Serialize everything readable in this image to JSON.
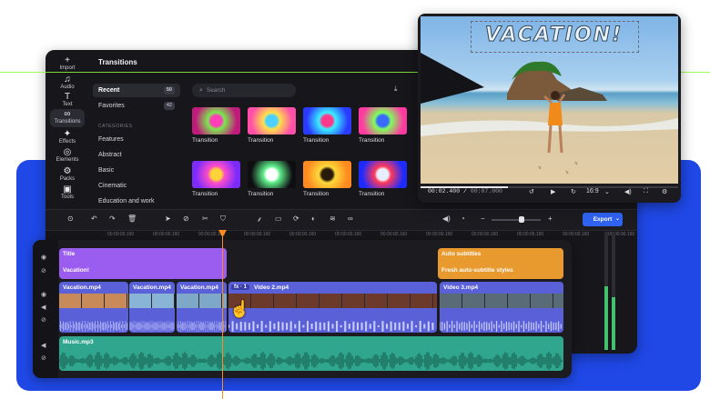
{
  "sidebar": {
    "items": [
      {
        "label": "Import",
        "icon": "plus-icon"
      },
      {
        "label": "Audio",
        "icon": "music-icon"
      },
      {
        "label": "Text",
        "icon": "text-icon"
      },
      {
        "label": "Transitions",
        "icon": "transitions-icon"
      },
      {
        "label": "Effects",
        "icon": "effects-icon"
      },
      {
        "label": "Elements",
        "icon": "elements-icon"
      },
      {
        "label": "Packs",
        "icon": "packs-icon"
      },
      {
        "label": "Tools",
        "icon": "tools-icon"
      }
    ],
    "active": "Transitions"
  },
  "panel": {
    "title": "Transitions",
    "categories": [
      {
        "label": "Recent",
        "count": "50"
      },
      {
        "label": "Favorites",
        "count": "42"
      }
    ],
    "categories_heading": "CATEGORIES",
    "category_list": [
      "Features",
      "Abstract",
      "Basic",
      "Cinematic",
      "Education and work"
    ],
    "search_placeholder": "Search",
    "thumbnails": [
      {
        "label": "Transition",
        "colors": [
          "#c01a7a",
          "#7be84f",
          "#ff3fb7"
        ]
      },
      {
        "label": "Transition",
        "colors": [
          "#ff4fa8",
          "#ffe14a",
          "#4ad1ff"
        ]
      },
      {
        "label": "Transition",
        "colors": [
          "#2a3bff",
          "#3af0ff",
          "#ff3a8c"
        ]
      },
      {
        "label": "Transition",
        "colors": [
          "#ff3aa1",
          "#7dff5a",
          "#3a6bff"
        ]
      },
      {
        "label": "Transition",
        "colors": [
          "#7c2bff",
          "#ff4ec6",
          "#ffd23a"
        ]
      },
      {
        "label": "Transition",
        "colors": [
          "#0f0f12",
          "#5ef08a",
          "#ffffff"
        ]
      },
      {
        "label": "Transition",
        "colors": [
          "#ff8a1f",
          "#ffd93a",
          "#2a1a0a"
        ]
      },
      {
        "label": "Transition",
        "colors": [
          "#1e2bff",
          "#ff3a5a",
          "#e8f0ff"
        ]
      }
    ]
  },
  "preview": {
    "overlay_title": "VACATION!",
    "time_current": "00:02.400",
    "time_total": "00:07.000",
    "progress": 0.34,
    "aspect": "16:9"
  },
  "toolbar": {
    "export_label": "Export",
    "ruler_ticks": [
      "00:00:00.160",
      "00:00:00.160",
      "00:00:00.160",
      "00:00:00.160",
      "00:00:00.160",
      "00:00:00.160",
      "00:00:00.160",
      "00:00:00.160",
      "00:00:00.160",
      "00:00:00.160",
      "00:00:00.160",
      "00:00:00.160"
    ]
  },
  "timeline": {
    "text_clips": [
      {
        "title": "Title",
        "subtitle": "Vacation!",
        "color": "#9b5cf0"
      },
      {
        "title": "Auto subtitles",
        "subtitle": "Fresh auto-subtitle styles",
        "color": "#e89a2f"
      }
    ],
    "video_clips": [
      {
        "label": "Vacation.mp4"
      },
      {
        "label": "Vacation.mp4"
      },
      {
        "label": "Vacation.mp4"
      },
      {
        "label": "Video 2.mp4",
        "badge": "fx · 1"
      },
      {
        "label": "Video 3.mp4"
      }
    ],
    "audio_clip": {
      "label": "Music.mp3",
      "color": "#2fa68d"
    }
  },
  "colors": {
    "accent": "#2f62f0",
    "playhead": "#ff8a1f",
    "background_panel": "#1f48e6"
  }
}
